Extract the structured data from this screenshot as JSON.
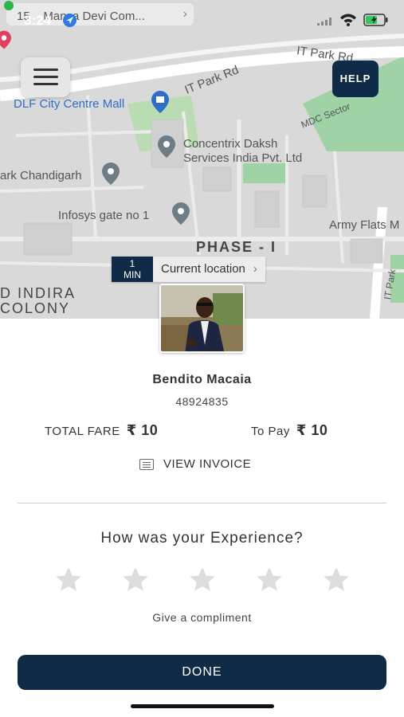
{
  "status_bar": {
    "time": "3:24",
    "notification_prefix": "15",
    "notification_text": "Mansa Devi Com..."
  },
  "map": {
    "labels": {
      "it_park_rd_1": "IT Park Rd",
      "it_park_rd_2": "IT Park Rd",
      "mdc_sector": "MDC Sector",
      "dlf_mall": "DLF City Centre Mall",
      "concentrix_1": "Concentrix Daksh",
      "concentrix_2": "Services India Pvt. Ltd",
      "park_chandigarh": "ark Chandigarh",
      "infosys": "Infosys gate no 1",
      "army_flats": "Army Flats M",
      "phase": "PHASE - I",
      "indira_1": "D INDIRA",
      "indira_2": "COLONY",
      "it_park_vertical": "IT Park"
    },
    "help_label": "HELP",
    "eta": {
      "value": "1",
      "unit": "MIN",
      "label": "Current location"
    }
  },
  "driver": {
    "name": "Bendito Macaia",
    "id": "48924835"
  },
  "fare": {
    "total_label": "TOTAL FARE",
    "total_value": "₹ 10",
    "pay_label": "To Pay",
    "pay_value": "₹ 10"
  },
  "invoice_label": "VIEW INVOICE",
  "rating": {
    "question": "How was your Experience?",
    "stars_total": 5,
    "stars_selected": 0,
    "compliment": "Give a compliment"
  },
  "done_label": "DONE",
  "colors": {
    "primary": "#0f2b47",
    "map_bg": "#d9d9d9",
    "star_empty": "#dcdcdc"
  }
}
